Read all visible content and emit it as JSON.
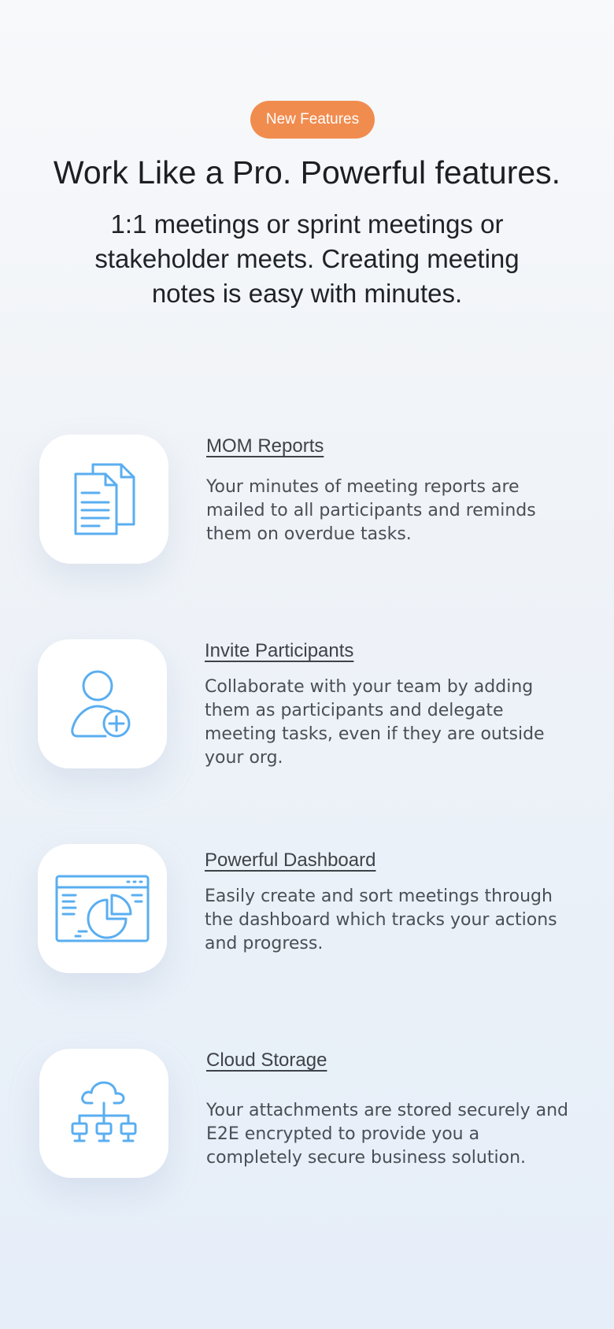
{
  "badge": {
    "label": "New Features",
    "color": "#f18c4f"
  },
  "headline": "Work Like a Pro. Powerful features.",
  "subheadline": "1:1 meetings or sprint meetings or stakeholder meets. Creating meeting notes is easy with minutes.",
  "accent_icon_color": "#5aaef0",
  "features": [
    {
      "icon": "documents-icon",
      "title": "MOM Reports",
      "description": "Your minutes of meeting reports are mailed to all participants and reminds them on overdue tasks."
    },
    {
      "icon": "add-user-icon",
      "title": "Invite Participants",
      "description": "Collaborate with your team by adding them as participants and delegate meeting tasks, even if they are outside your org."
    },
    {
      "icon": "dashboard-chart-icon",
      "title": "Powerful Dashboard",
      "description": "Easily create and sort meetings through the dashboard which tracks your actions and progress."
    },
    {
      "icon": "cloud-network-icon",
      "title": "Cloud Storage",
      "description": "Your attachments are stored securely and E2E encrypted to provide you a completely secure business solution."
    }
  ]
}
